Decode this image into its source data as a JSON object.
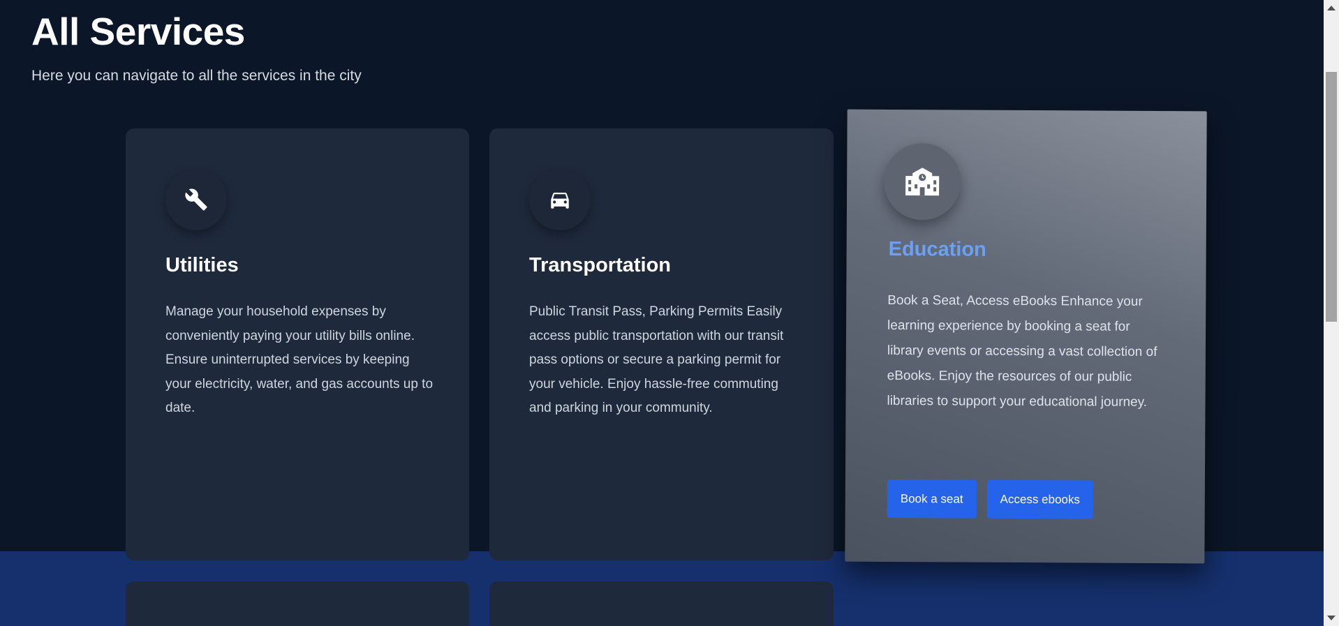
{
  "header": {
    "title": "All Services",
    "subtitle": "Here you can navigate to all the services in the city"
  },
  "cards": [
    {
      "icon": "wrench-icon",
      "title": "Utilities",
      "description": "Manage your household expenses by conveniently paying your utility bills online. Ensure uninterrupted services by keeping your electricity, water, and gas accounts up to date."
    },
    {
      "icon": "car-icon",
      "title": "Transportation",
      "description": "Public Transit Pass, Parking Permits Easily access public transportation with our transit pass options or secure a parking permit for your vehicle. Enjoy hassle-free commuting and parking in your community."
    },
    {
      "icon": "school-icon",
      "title": "Education",
      "description": "Book a Seat, Access eBooks Enhance your learning experience by booking a seat for library events or accessing a vast collection of eBooks. Enjoy the resources of our public libraries to support your educational journey.",
      "buttons": [
        "Book a seat",
        "Access ebooks"
      ]
    }
  ],
  "colors": {
    "background": "#0b1628",
    "card": "#1e293b",
    "accent_button": "#2563eb",
    "education_title": "#6aa1f5",
    "bottom_band": "#15306d"
  }
}
